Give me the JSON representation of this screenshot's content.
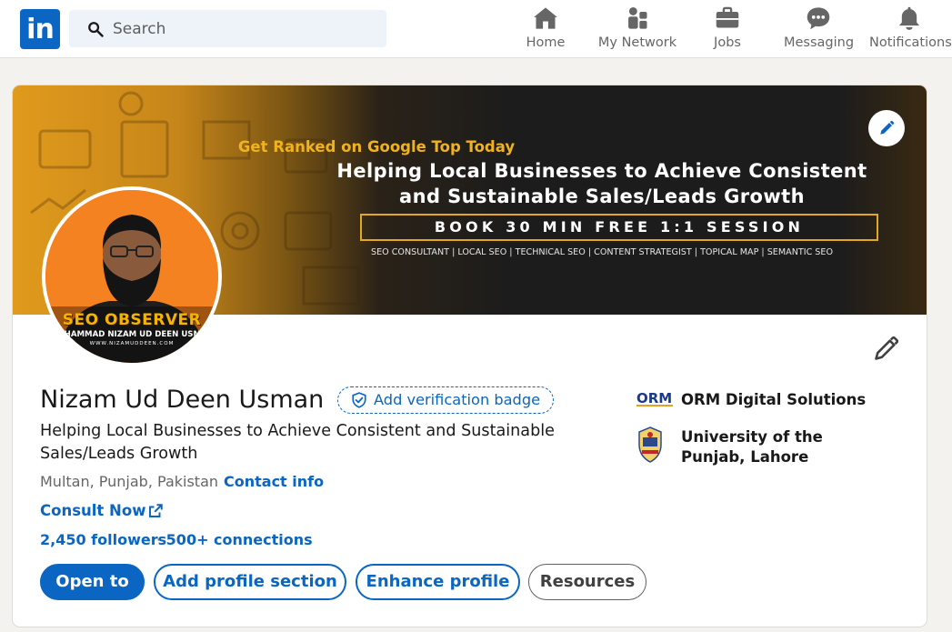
{
  "nav": {
    "logo_text": "in",
    "search_placeholder": "Search",
    "items": [
      {
        "label": "Home",
        "icon": "home-icon"
      },
      {
        "label": "My Network",
        "icon": "network-icon"
      },
      {
        "label": "Jobs",
        "icon": "briefcase-icon"
      },
      {
        "label": "Messaging",
        "icon": "messaging-icon"
      },
      {
        "label": "Notifications",
        "icon": "bell-icon"
      }
    ]
  },
  "banner": {
    "tagline": "Get Ranked on Google Top Today",
    "headline_line1": "Helping Local Businesses to Achieve Consistent",
    "headline_line2": "and Sustainable Sales/Leads Growth",
    "cta": "BOOK 30 MIN FREE 1:1 SESSION",
    "services": "SEO CONSULTANT | LOCAL SEO | TECHNICAL SEO | CONTENT STRATEGIST | TOPICAL MAP | SEMANTIC SEO"
  },
  "avatar": {
    "brand": "SEO OBSERVER",
    "owner": "MUHAMMAD NIZAM UD DEEN USMAN",
    "site": "WWW.NIZAMUDDEEN.COM"
  },
  "profile": {
    "name": "Nizam Ud Deen Usman",
    "verify_label": "Add verification badge",
    "headline": "Helping Local Businesses to Achieve Consistent and Sustainable Sales/Leads Growth",
    "location": "Multan, Punjab, Pakistan",
    "location_sep": " · ",
    "contact_label": "Contact info",
    "consult_label": "Consult Now",
    "followers": "2,450 followers",
    "connections": "500+ connections"
  },
  "actions": {
    "open_to": "Open to",
    "add_section": "Add profile section",
    "enhance": "Enhance profile",
    "resources": "Resources"
  },
  "orgs": [
    {
      "name": "ORM Digital Solutions",
      "logo_text": "ORM"
    },
    {
      "name": "University of the Punjab, Lahore"
    }
  ],
  "colors": {
    "brand_blue": "#0a66c2",
    "banner_gold": "#f0b21d",
    "avatar_orange": "#f58220"
  }
}
